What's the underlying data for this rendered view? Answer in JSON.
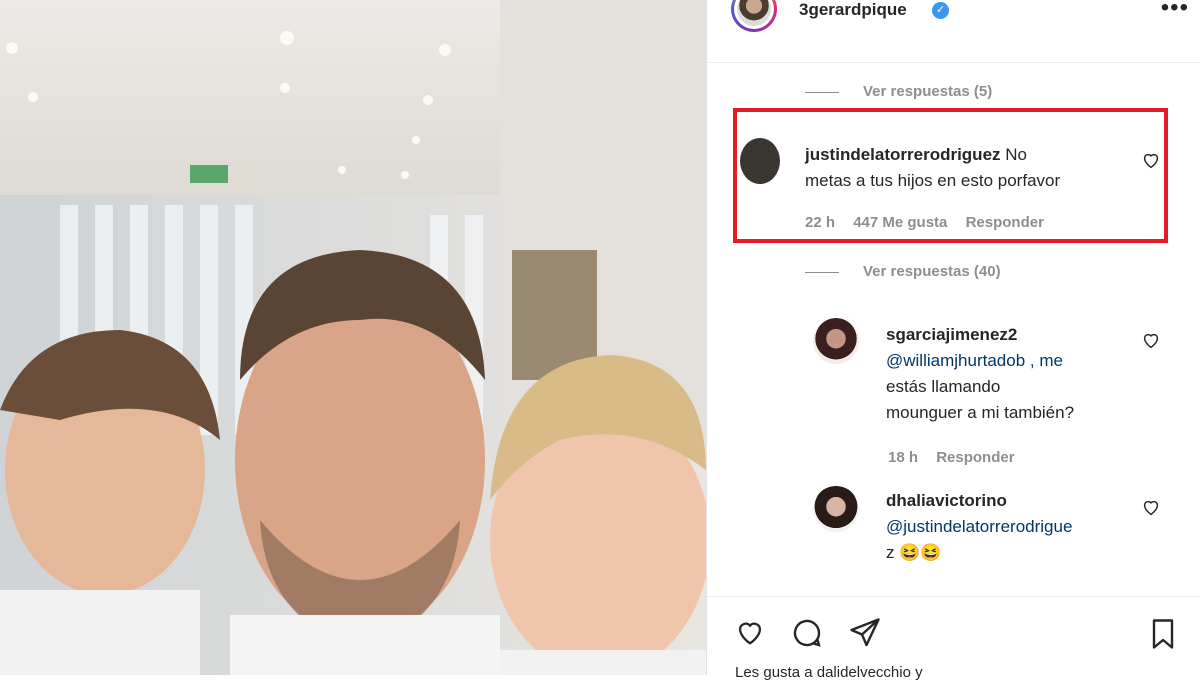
{
  "post": {
    "username": "3gerardpique",
    "more_label": "•••"
  },
  "comments": {
    "view_replies_1": "Ver respuestas (5)",
    "view_replies_2": "Ver respuestas (40)",
    "highlighted": {
      "user": "justindelatorrerodriguez",
      "text_line1": "No",
      "text_line2": "metas a tus hijos en esto porfavor",
      "time": "22 h",
      "likes": "447 Me gusta",
      "reply": "Responder"
    },
    "reply1": {
      "user": "sgarciajimenez2",
      "line1": "@williamjhurtadob , me",
      "line2": "estás llamando",
      "line3": "mounguer a mi también?",
      "time": "18 h",
      "reply": "Responder"
    },
    "reply2": {
      "user": "dhaliavictorino",
      "line1": "@justindelatorrerodrigue",
      "line2": "z 😆😆"
    }
  },
  "footer": {
    "likes_text": "Les gusta a dalidelvecchio y"
  },
  "colors": {
    "highlight": "#e21b26",
    "verified": "#3897f0",
    "muted": "#8e8e8e",
    "text": "#262626"
  },
  "icons": [
    "verified-icon",
    "heart-icon",
    "comment-icon",
    "share-icon",
    "bookmark-icon",
    "more-icon"
  ]
}
